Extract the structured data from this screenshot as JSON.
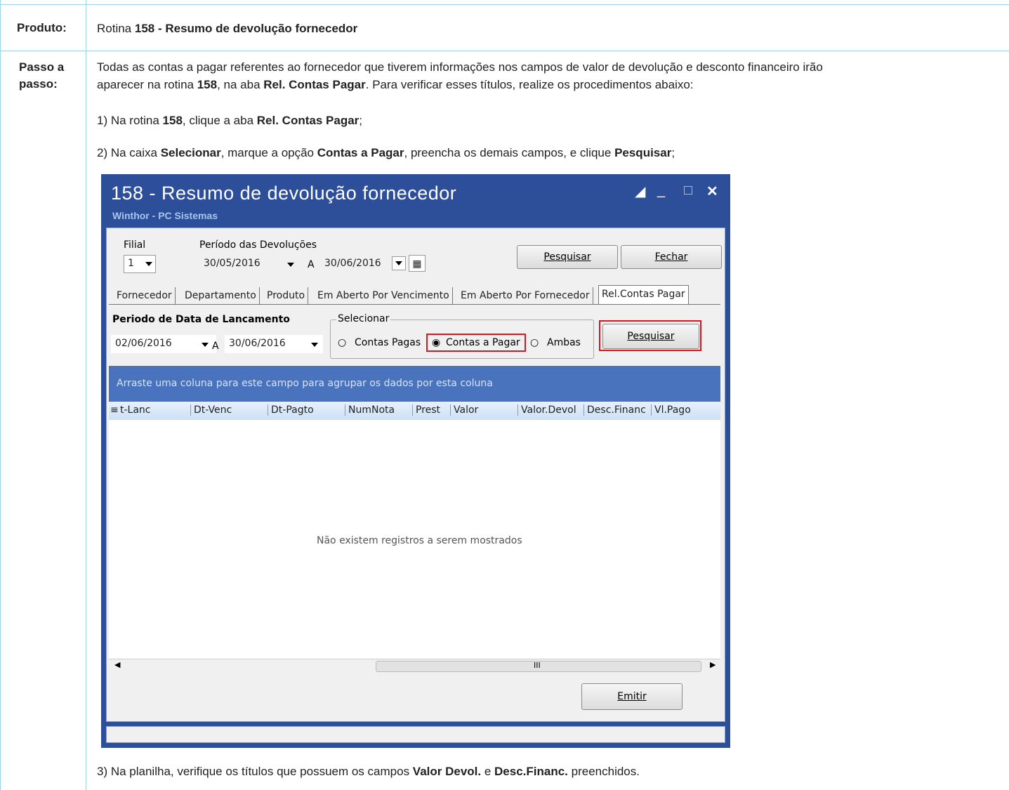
{
  "rows": {
    "produto_label": "Produto:",
    "produto_prefix": "Rotina ",
    "produto_bold": "158 - Resumo de devolução fornecedor",
    "passo_label_1": "Passo a",
    "passo_label_2": "passo:"
  },
  "steps": {
    "intro_line1": "Todas as contas a pagar referentes ao fornecedor que tiverem informações nos campos de valor de devolução e desconto financeiro irão",
    "intro_line2_a": "aparecer na rotina ",
    "intro_line2_b": "158",
    "intro_line2_c": ", na aba ",
    "intro_line2_d": "Rel. Contas Pagar",
    "intro_line2_e": ". Para verificar esses títulos, realize os procedimentos abaixo:",
    "s1_a": "1) Na rotina ",
    "s1_b": "158",
    "s1_c": ", clique a aba ",
    "s1_d": "Rel. Contas Pagar",
    "s1_e": ";",
    "s2_a": "2) Na caixa ",
    "s2_b": "Selecionar",
    "s2_c": ", marque a opção ",
    "s2_d": "Contas a Pagar",
    "s2_e": ", preencha os demais campos, e clique ",
    "s2_f": "Pesquisar",
    "s2_g": ";",
    "s3_a": "3) Na planilha, verifique os títulos que possuem os campos ",
    "s3_b": "Valor Devol.",
    "s3_c": " e ",
    "s3_d": "Desc.Financ.",
    "s3_e": " preenchidos."
  },
  "window": {
    "title": "158 - Resumo de devolução fornecedor",
    "subtitle": "Winthor - PC Sistemas",
    "filial_label": "Filial",
    "filial_value": "1",
    "periodo_label": "Período das Devoluções",
    "periodo_from": "30/05/2016",
    "periodo_sep": "A",
    "periodo_to": "30/06/2016",
    "btn_pesquisar_top": "Pesquisar",
    "btn_fechar": "Fechar",
    "tabs": [
      "Fornecedor",
      "Departamento",
      "Produto",
      "Em Aberto Por Vencimento",
      "Em Aberto Por Fornecedor",
      "Rel.Contas Pagar"
    ],
    "lanc_label": "Periodo de Data de Lancamento",
    "lanc_from": "02/06/2016",
    "lanc_sep": "A",
    "lanc_to": "30/06/2016",
    "selecionar_label": "Selecionar",
    "radio_pagas": "Contas Pagas",
    "radio_pagar": "Contas a Pagar",
    "radio_ambas": "Ambas",
    "btn_pesquisar": "Pesquisar",
    "group_hint": "Arraste uma coluna para este campo para agrupar os dados por esta coluna",
    "columns": [
      "t-Lanc",
      "Dt-Venc",
      "Dt-Pagto",
      "NumNota",
      "Prest",
      "Valor",
      "Valor.Devol",
      "Desc.Financ",
      "Vl.Pago"
    ],
    "empty_msg": "Não existem registros a serem mostrados",
    "scroll_mark": "III",
    "btn_emitir": "Emitir"
  }
}
